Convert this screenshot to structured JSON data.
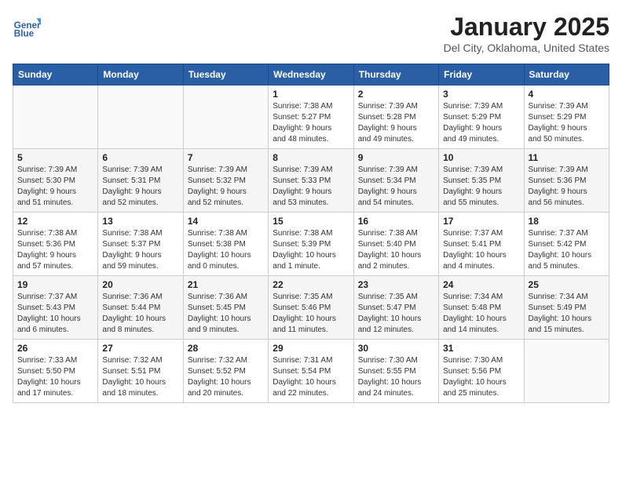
{
  "header": {
    "logo_line1": "General",
    "logo_line2": "Blue",
    "month": "January 2025",
    "location": "Del City, Oklahoma, United States"
  },
  "days_of_week": [
    "Sunday",
    "Monday",
    "Tuesday",
    "Wednesday",
    "Thursday",
    "Friday",
    "Saturday"
  ],
  "weeks": [
    [
      {
        "day": "",
        "info": ""
      },
      {
        "day": "",
        "info": ""
      },
      {
        "day": "",
        "info": ""
      },
      {
        "day": "1",
        "info": "Sunrise: 7:38 AM\nSunset: 5:27 PM\nDaylight: 9 hours\nand 48 minutes."
      },
      {
        "day": "2",
        "info": "Sunrise: 7:39 AM\nSunset: 5:28 PM\nDaylight: 9 hours\nand 49 minutes."
      },
      {
        "day": "3",
        "info": "Sunrise: 7:39 AM\nSunset: 5:29 PM\nDaylight: 9 hours\nand 49 minutes."
      },
      {
        "day": "4",
        "info": "Sunrise: 7:39 AM\nSunset: 5:29 PM\nDaylight: 9 hours\nand 50 minutes."
      }
    ],
    [
      {
        "day": "5",
        "info": "Sunrise: 7:39 AM\nSunset: 5:30 PM\nDaylight: 9 hours\nand 51 minutes."
      },
      {
        "day": "6",
        "info": "Sunrise: 7:39 AM\nSunset: 5:31 PM\nDaylight: 9 hours\nand 52 minutes."
      },
      {
        "day": "7",
        "info": "Sunrise: 7:39 AM\nSunset: 5:32 PM\nDaylight: 9 hours\nand 52 minutes."
      },
      {
        "day": "8",
        "info": "Sunrise: 7:39 AM\nSunset: 5:33 PM\nDaylight: 9 hours\nand 53 minutes."
      },
      {
        "day": "9",
        "info": "Sunrise: 7:39 AM\nSunset: 5:34 PM\nDaylight: 9 hours\nand 54 minutes."
      },
      {
        "day": "10",
        "info": "Sunrise: 7:39 AM\nSunset: 5:35 PM\nDaylight: 9 hours\nand 55 minutes."
      },
      {
        "day": "11",
        "info": "Sunrise: 7:39 AM\nSunset: 5:36 PM\nDaylight: 9 hours\nand 56 minutes."
      }
    ],
    [
      {
        "day": "12",
        "info": "Sunrise: 7:38 AM\nSunset: 5:36 PM\nDaylight: 9 hours\nand 57 minutes."
      },
      {
        "day": "13",
        "info": "Sunrise: 7:38 AM\nSunset: 5:37 PM\nDaylight: 9 hours\nand 59 minutes."
      },
      {
        "day": "14",
        "info": "Sunrise: 7:38 AM\nSunset: 5:38 PM\nDaylight: 10 hours\nand 0 minutes."
      },
      {
        "day": "15",
        "info": "Sunrise: 7:38 AM\nSunset: 5:39 PM\nDaylight: 10 hours\nand 1 minute."
      },
      {
        "day": "16",
        "info": "Sunrise: 7:38 AM\nSunset: 5:40 PM\nDaylight: 10 hours\nand 2 minutes."
      },
      {
        "day": "17",
        "info": "Sunrise: 7:37 AM\nSunset: 5:41 PM\nDaylight: 10 hours\nand 4 minutes."
      },
      {
        "day": "18",
        "info": "Sunrise: 7:37 AM\nSunset: 5:42 PM\nDaylight: 10 hours\nand 5 minutes."
      }
    ],
    [
      {
        "day": "19",
        "info": "Sunrise: 7:37 AM\nSunset: 5:43 PM\nDaylight: 10 hours\nand 6 minutes."
      },
      {
        "day": "20",
        "info": "Sunrise: 7:36 AM\nSunset: 5:44 PM\nDaylight: 10 hours\nand 8 minutes."
      },
      {
        "day": "21",
        "info": "Sunrise: 7:36 AM\nSunset: 5:45 PM\nDaylight: 10 hours\nand 9 minutes."
      },
      {
        "day": "22",
        "info": "Sunrise: 7:35 AM\nSunset: 5:46 PM\nDaylight: 10 hours\nand 11 minutes."
      },
      {
        "day": "23",
        "info": "Sunrise: 7:35 AM\nSunset: 5:47 PM\nDaylight: 10 hours\nand 12 minutes."
      },
      {
        "day": "24",
        "info": "Sunrise: 7:34 AM\nSunset: 5:48 PM\nDaylight: 10 hours\nand 14 minutes."
      },
      {
        "day": "25",
        "info": "Sunrise: 7:34 AM\nSunset: 5:49 PM\nDaylight: 10 hours\nand 15 minutes."
      }
    ],
    [
      {
        "day": "26",
        "info": "Sunrise: 7:33 AM\nSunset: 5:50 PM\nDaylight: 10 hours\nand 17 minutes."
      },
      {
        "day": "27",
        "info": "Sunrise: 7:32 AM\nSunset: 5:51 PM\nDaylight: 10 hours\nand 18 minutes."
      },
      {
        "day": "28",
        "info": "Sunrise: 7:32 AM\nSunset: 5:52 PM\nDaylight: 10 hours\nand 20 minutes."
      },
      {
        "day": "29",
        "info": "Sunrise: 7:31 AM\nSunset: 5:54 PM\nDaylight: 10 hours\nand 22 minutes."
      },
      {
        "day": "30",
        "info": "Sunrise: 7:30 AM\nSunset: 5:55 PM\nDaylight: 10 hours\nand 24 minutes."
      },
      {
        "day": "31",
        "info": "Sunrise: 7:30 AM\nSunset: 5:56 PM\nDaylight: 10 hours\nand 25 minutes."
      },
      {
        "day": "",
        "info": ""
      }
    ]
  ]
}
